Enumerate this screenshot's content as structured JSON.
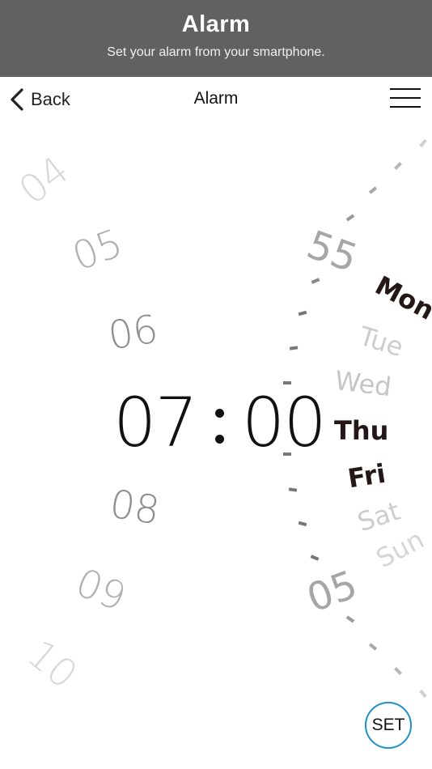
{
  "banner": {
    "title": "Alarm",
    "subtitle": "Set your alarm from your smartphone."
  },
  "nav": {
    "back_label": "Back",
    "back_icon": "chevron-left-icon",
    "title": "Alarm",
    "menu_icon": "hamburger-menu-icon"
  },
  "hours": {
    "h04": "04",
    "h05": "05",
    "h06": "06",
    "h08": "08",
    "h09": "09",
    "h10": "10"
  },
  "time": {
    "hour": "07",
    "minute": "00"
  },
  "minutes": {
    "m55": "55",
    "m05": "05"
  },
  "days": {
    "mon": "Mon",
    "tue": "Tue",
    "wed": "Wed",
    "thu": "Thu",
    "fri": "Fri",
    "sat": "Sat",
    "sun": "Sun"
  },
  "days_selected": [
    "Mon",
    "Thu",
    "Fri"
  ],
  "set_label": "SET",
  "colors": {
    "banner_bg": "#616161",
    "set_border": "#1e90c8",
    "active_day": "#231815",
    "inactive_day": "#c8c8c8"
  }
}
